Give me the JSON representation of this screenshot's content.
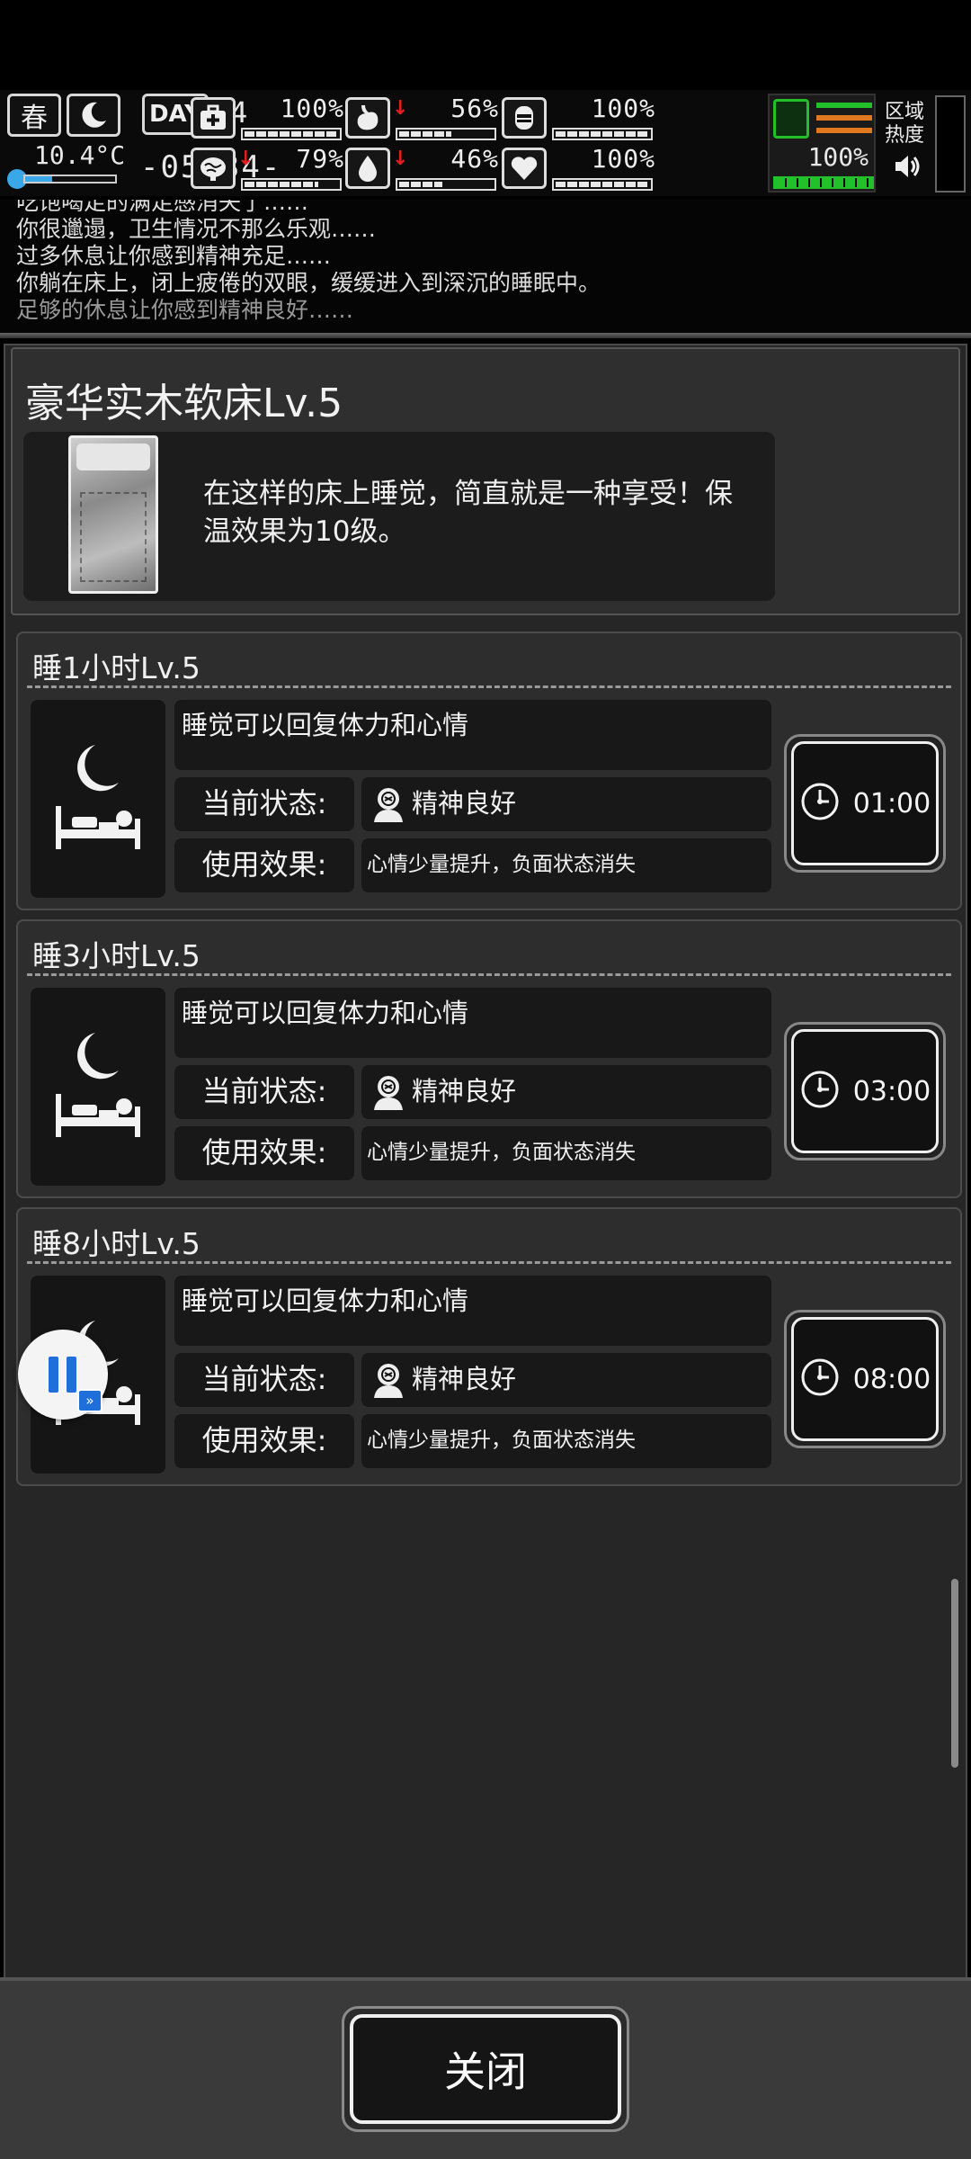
{
  "hud": {
    "season": "春",
    "temperature": "10.4°C",
    "day_label": "DAY",
    "day_number": "4",
    "clock": "-05:34-",
    "region_heat": "区域热度",
    "stats": [
      {
        "name": "health",
        "icon": "medkit-icon",
        "value": "100%",
        "level": 1.0,
        "decreasing": false
      },
      {
        "name": "stomach",
        "icon": "stomach-icon",
        "value": "56%",
        "level": 0.56,
        "decreasing": true
      },
      {
        "name": "armor",
        "icon": "armor-icon",
        "value": "100%",
        "level": 1.0,
        "decreasing": false
      },
      {
        "name": "mind",
        "icon": "brain-icon",
        "value": "79%",
        "level": 0.79,
        "decreasing": true
      },
      {
        "name": "water",
        "icon": "water-drop-icon",
        "value": "46%",
        "level": 0.46,
        "decreasing": true
      },
      {
        "name": "mood",
        "icon": "heart-icon",
        "value": "100%",
        "level": 1.0,
        "decreasing": false
      }
    ],
    "stamina_value": "100%",
    "stamina_level": 1.0,
    "accent_green": "#22c02a",
    "accent_orange": "#e07820"
  },
  "log": [
    "吃饱喝足的满足感消失了……",
    "你很邋遢，卫生情况不那么乐观……",
    "过多休息让你感到精神充足……",
    "你躺在床上，闭上疲倦的双眼，缓缓进入到深沉的睡眠中。",
    "足够的休息让你感到精神良好……"
  ],
  "bed": {
    "title": "豪华实木软床Lv.5",
    "description": "在这样的床上睡觉，简直就是一种享受！保温效果为10级。"
  },
  "sleep_options": [
    {
      "title": "睡1小时Lv.5",
      "desc": "睡觉可以回复体力和心情",
      "status_label": "当前状态:",
      "status_value": "精神良好",
      "effect_label": "使用效果:",
      "effect_value": "心情少量提升，负面状态消失",
      "time": "01:00"
    },
    {
      "title": "睡3小时Lv.5",
      "desc": "睡觉可以回复体力和心情",
      "status_label": "当前状态:",
      "status_value": "精神良好",
      "effect_label": "使用效果:",
      "effect_value": "心情少量提升，负面状态消失",
      "time": "03:00"
    },
    {
      "title": "睡8小时Lv.5",
      "desc": "睡觉可以回复体力和心情",
      "status_label": "当前状态:",
      "status_value": "精神良好",
      "effect_label": "使用效果:",
      "effect_value": "心情少量提升，负面状态消失",
      "time": "08:00"
    }
  ],
  "close_label": "关闭"
}
